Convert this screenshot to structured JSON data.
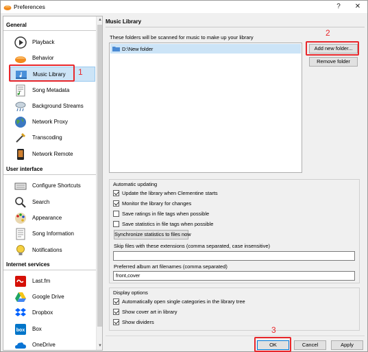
{
  "window": {
    "title": "Preferences",
    "help_glyph": "?",
    "close_glyph": "✕"
  },
  "sidebar": {
    "sections": [
      {
        "title": "General"
      },
      {
        "title": "User interface"
      },
      {
        "title": "Internet services"
      }
    ],
    "items": [
      {
        "label": "Playback",
        "icon": "play-icon"
      },
      {
        "label": "Behavior",
        "icon": "clementine-icon"
      },
      {
        "label": "Music Library",
        "icon": "music-library-icon",
        "selected": true
      },
      {
        "label": "Song Metadata",
        "icon": "song-metadata-icon"
      },
      {
        "label": "Background Streams",
        "icon": "cloud-rain-icon"
      },
      {
        "label": "Network Proxy",
        "icon": "globe-icon"
      },
      {
        "label": "Transcoding",
        "icon": "transcoding-icon"
      },
      {
        "label": "Network Remote",
        "icon": "phone-icon"
      },
      {
        "label": "Configure Shortcuts",
        "icon": "keyboard-icon"
      },
      {
        "label": "Search",
        "icon": "magnifier-icon"
      },
      {
        "label": "Appearance",
        "icon": "palette-icon"
      },
      {
        "label": "Song Information",
        "icon": "song-info-icon"
      },
      {
        "label": "Notifications",
        "icon": "lightbulb-icon"
      },
      {
        "label": "Last.fm",
        "icon": "lastfm-icon"
      },
      {
        "label": "Google Drive",
        "icon": "google-drive-icon"
      },
      {
        "label": "Dropbox",
        "icon": "dropbox-icon"
      },
      {
        "label": "Box",
        "icon": "box-icon"
      },
      {
        "label": "OneDrive",
        "icon": "onedrive-icon"
      }
    ]
  },
  "panel": {
    "title": "Music Library",
    "scan_label": "These folders will be scanned for music to make up your library",
    "folders": [
      "D:\\New folder"
    ],
    "add_folder_label": "Add new folder...",
    "remove_folder_label": "Remove folder"
  },
  "auto_update": {
    "title": "Automatic updating",
    "checks": [
      {
        "label": "Update the library when Clementine starts",
        "checked": true
      },
      {
        "label": "Monitor the library for changes",
        "checked": true
      },
      {
        "label": "Save ratings in file tags when possible",
        "checked": false
      },
      {
        "label": "Save statistics in file tags when possible",
        "checked": false
      }
    ],
    "sync_button": "Synchronize statistics to files now",
    "skip_label": "Skip files with these extensions (comma separated, case insensitive)",
    "skip_value": "",
    "art_label": "Preferred album art filenames (comma separated)",
    "art_value": "front,cover"
  },
  "display_options": {
    "title": "Display options",
    "checks": [
      {
        "label": "Automatically open single categories in the library tree",
        "checked": true
      },
      {
        "label": "Show cover art in library",
        "checked": true
      },
      {
        "label": "Show dividers",
        "checked": true
      }
    ]
  },
  "footer": {
    "ok_label": "OK",
    "cancel_label": "Cancel",
    "apply_label": "Apply"
  },
  "callouts": [
    "1",
    "2",
    "3"
  ],
  "colors": {
    "callout": "#e8262a",
    "selection": "#cce4f7",
    "selection_border": "#99c9ef",
    "default_button_border": "#0078d7"
  }
}
